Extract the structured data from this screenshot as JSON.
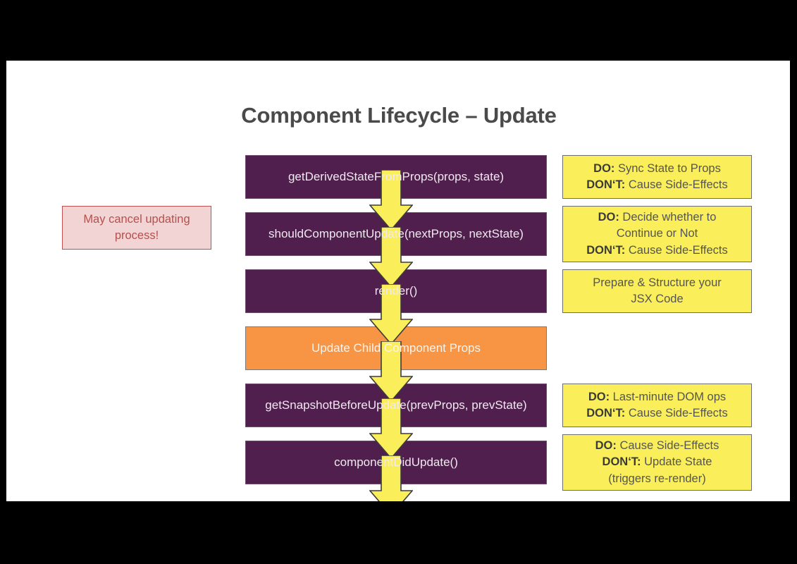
{
  "slide": {
    "title": "Component Lifecycle – Update",
    "background_color": "#000000",
    "canvas_color": "#ffffff"
  },
  "colors": {
    "phase_box": "#501F4E",
    "child_props_box": "#F79544",
    "note_box": "#FAEF5A",
    "arrow": "#FAEF5A",
    "arrow_outline": "#3b3b3b",
    "cancel_note_bg": "#F3D4D4",
    "cancel_note_border": "#C0504D",
    "cancel_note_text": "#B4504D",
    "title_text": "#4a4a4a"
  },
  "lifecycle": {
    "steps": [
      {
        "label": "getDerivedStateFromProps(props, state)",
        "kind": "phase"
      },
      {
        "label": "shouldComponentUpdate(nextProps, nextState)",
        "kind": "phase"
      },
      {
        "label": "render()",
        "kind": "phase"
      },
      {
        "label": "Update Child Component Props",
        "kind": "child-props"
      },
      {
        "label": "getSnapshotBeforeUpdate(prevProps, prevState)",
        "kind": "phase"
      },
      {
        "label": "componentDidUpdate()",
        "kind": "phase"
      }
    ]
  },
  "notes": [
    {
      "lines": [
        {
          "strong": "DO:",
          "text": " Sync State to Props"
        },
        {
          "strong": "DON‘T:",
          "text": " Cause Side-Effects"
        }
      ]
    },
    {
      "lines": [
        {
          "strong": "DO:",
          "text": " Decide whether to"
        },
        {
          "strong": "",
          "text": "Continue or Not"
        },
        {
          "strong": "DON‘T:",
          "text": " Cause Side-Effects"
        }
      ]
    },
    {
      "lines": [
        {
          "strong": "",
          "text": "Prepare & Structure your"
        },
        {
          "strong": "",
          "text": "JSX Code"
        }
      ]
    },
    {
      "lines": [
        {
          "strong": "DO:",
          "text": " Last-minute DOM ops"
        },
        {
          "strong": "DON‘T:",
          "text": " Cause Side-Effects"
        }
      ]
    },
    {
      "lines": [
        {
          "strong": "DO:",
          "text": " Cause Side-Effects"
        },
        {
          "strong": "DON‘T:",
          "text": " Update State"
        },
        {
          "strong": "",
          "text": "(triggers re-render)"
        }
      ]
    }
  ],
  "cancel_note": {
    "text": "May cancel updating process!"
  }
}
